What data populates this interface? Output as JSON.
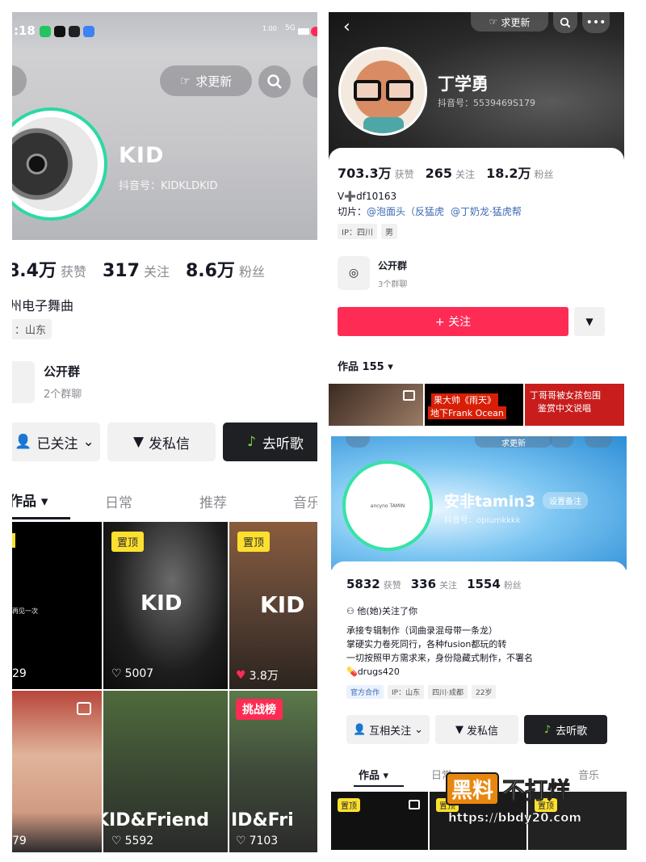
{
  "panel_a": {
    "status": {
      "time": ":18",
      "net": "1.00\nKB/s",
      "sig": "5G"
    },
    "update_button": "求更新",
    "name": "KID",
    "douyin_id": "抖音号：KIDKLDKID",
    "stats": [
      {
        "value": "8.4万",
        "label": "获赞"
      },
      {
        "value": "317",
        "label": "关注"
      },
      {
        "value": "8.6万",
        "label": "粉丝"
      }
    ],
    "bio": "州电子舞曲",
    "location_tag": "：山东",
    "group": {
      "title": "公开群",
      "subtitle": "2个群聊"
    },
    "buttons": {
      "followed": "已关注",
      "message": "发私信",
      "listen": "去听歌"
    },
    "tabs": [
      "作品",
      "日常",
      "推荐",
      "音乐"
    ],
    "videos": [
      {
        "pin": "",
        "caption": "再见一次",
        "likes": "29",
        "overlay": ""
      },
      {
        "pin": "置顶",
        "caption": "",
        "likes": "5007",
        "overlay": "KID"
      },
      {
        "pin": "置顶",
        "caption": "",
        "likes": "3.8万",
        "overlay": "KID"
      },
      {
        "pin": "",
        "caption": "",
        "likes": "79",
        "overlay": ""
      },
      {
        "pin": "",
        "caption": "",
        "likes": "5592",
        "overlay": "KID&Friend"
      },
      {
        "pin": "挑战榜",
        "caption": "",
        "likes": "7103",
        "overlay": "ID&Fri"
      }
    ]
  },
  "panel_b": {
    "update_button": "求更新",
    "name": "丁学勇",
    "douyin_id": "抖音号：5539469S179",
    "stats": [
      {
        "value": "703.3万",
        "label": "获赞"
      },
      {
        "value": "265",
        "label": "关注"
      },
      {
        "value": "18.2万",
        "label": "粉丝"
      }
    ],
    "bio_line1": "V➕df10163",
    "bio_line2_prefix": "切片：",
    "bio_line2_link1": "@泡面头（反猛虎",
    "bio_line2_link2": "@丁奶龙·猛虎帮",
    "tags": [
      "IP：四川",
      "男"
    ],
    "group": {
      "title": "公开群",
      "subtitle": "3个群聊"
    },
    "follow_button": "+ 关注",
    "works": "作品 155",
    "thumbs": [
      {
        "text1": "",
        "text2": ""
      },
      {
        "text1": "果大帅《雨天》",
        "text2": "地下Frank Ocean"
      },
      {
        "text1": "丁哥哥被女孩包围",
        "text2": "鉴赏中文说唱"
      }
    ]
  },
  "panel_c": {
    "update_button": "求更新",
    "avatar_text": "ancyno TAMIN",
    "name": "安非tamin3",
    "remark": "设置备注",
    "douyin_id": "抖音号：opiumkkkk",
    "stats": [
      {
        "value": "5832",
        "label": "获赞"
      },
      {
        "value": "336",
        "label": "关注"
      },
      {
        "value": "1554",
        "label": "粉丝"
      }
    ],
    "follows_you": "他(她)关注了你",
    "bio": [
      "承接专辑制作（词曲录混母带一条龙）",
      "掌硬实力卷死同行，各种fusion都玩的转",
      "一切按照甲方需求来，身份隐藏式制作，不署名",
      "drugs420"
    ],
    "tags": [
      "官方合作",
      "IP：山东",
      "四川·成都",
      "22岁"
    ],
    "buttons": {
      "mutual": "互相关注",
      "message": "发私信",
      "listen": "去听歌"
    },
    "tabs": [
      "作品",
      "日常",
      "",
      "音乐"
    ],
    "pin": "置顶"
  },
  "watermark": {
    "text1": "黑料",
    "text2": "不打烊",
    "url": "https://bbdy20.com"
  }
}
